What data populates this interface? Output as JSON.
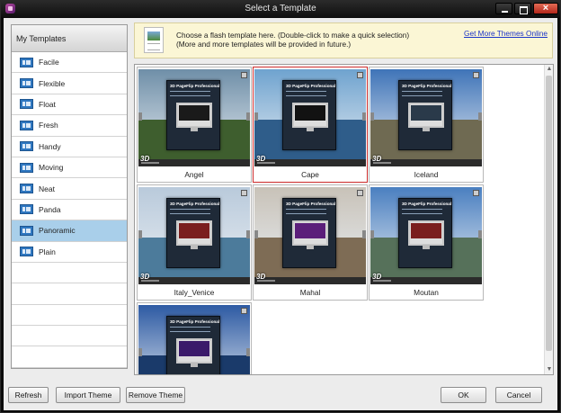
{
  "window": {
    "title": "Select a Template"
  },
  "sidebar": {
    "header": "My Templates",
    "items": [
      {
        "label": "Facile"
      },
      {
        "label": "Flexible"
      },
      {
        "label": "Float"
      },
      {
        "label": "Fresh"
      },
      {
        "label": "Handy"
      },
      {
        "label": "Moving"
      },
      {
        "label": "Neat"
      },
      {
        "label": "Panda"
      },
      {
        "label": "Panoramic",
        "selected": true
      },
      {
        "label": "Plain"
      }
    ]
  },
  "banner": {
    "line1": "Choose a flash template here. (Double-click to make a quick selection)",
    "line2": "(More and more templates will be provided in future.)",
    "link": "Get More Themes Online"
  },
  "thumbnail_book_title": "3D PageFlip Professional",
  "thumbnail_badge": "3D",
  "templates": [
    {
      "name": "Angel",
      "sky": "#6f8fa8",
      "ground": "#3e5e2e",
      "screen": "#1a1a1a"
    },
    {
      "name": "Cape",
      "selected": true,
      "sky": "#6fa3cf",
      "ground": "#2f5d8a",
      "screen": "#121212"
    },
    {
      "name": "Iceland",
      "sky": "#3f74b8",
      "ground": "#6f6a52",
      "screen": "#2a3a4a"
    },
    {
      "name": "Italy_Venice",
      "sky": "#b9cadb",
      "ground": "#4c7b9b",
      "screen": "#7a1e1e"
    },
    {
      "name": "Mahal",
      "sky": "#c8c2b8",
      "ground": "#7e6c55",
      "screen": "#5b1e7a"
    },
    {
      "name": "Moutan",
      "sky": "#4a7fc0",
      "ground": "#56715a",
      "screen": "#7a1e1e"
    },
    {
      "name": "",
      "sky": "#2d5aa3",
      "ground": "#1a3a6a",
      "screen": "#3a1a6a"
    }
  ],
  "buttons": {
    "refresh": "Refresh",
    "import": "Import Theme",
    "remove": "Remove Theme",
    "ok": "OK",
    "cancel": "Cancel"
  }
}
